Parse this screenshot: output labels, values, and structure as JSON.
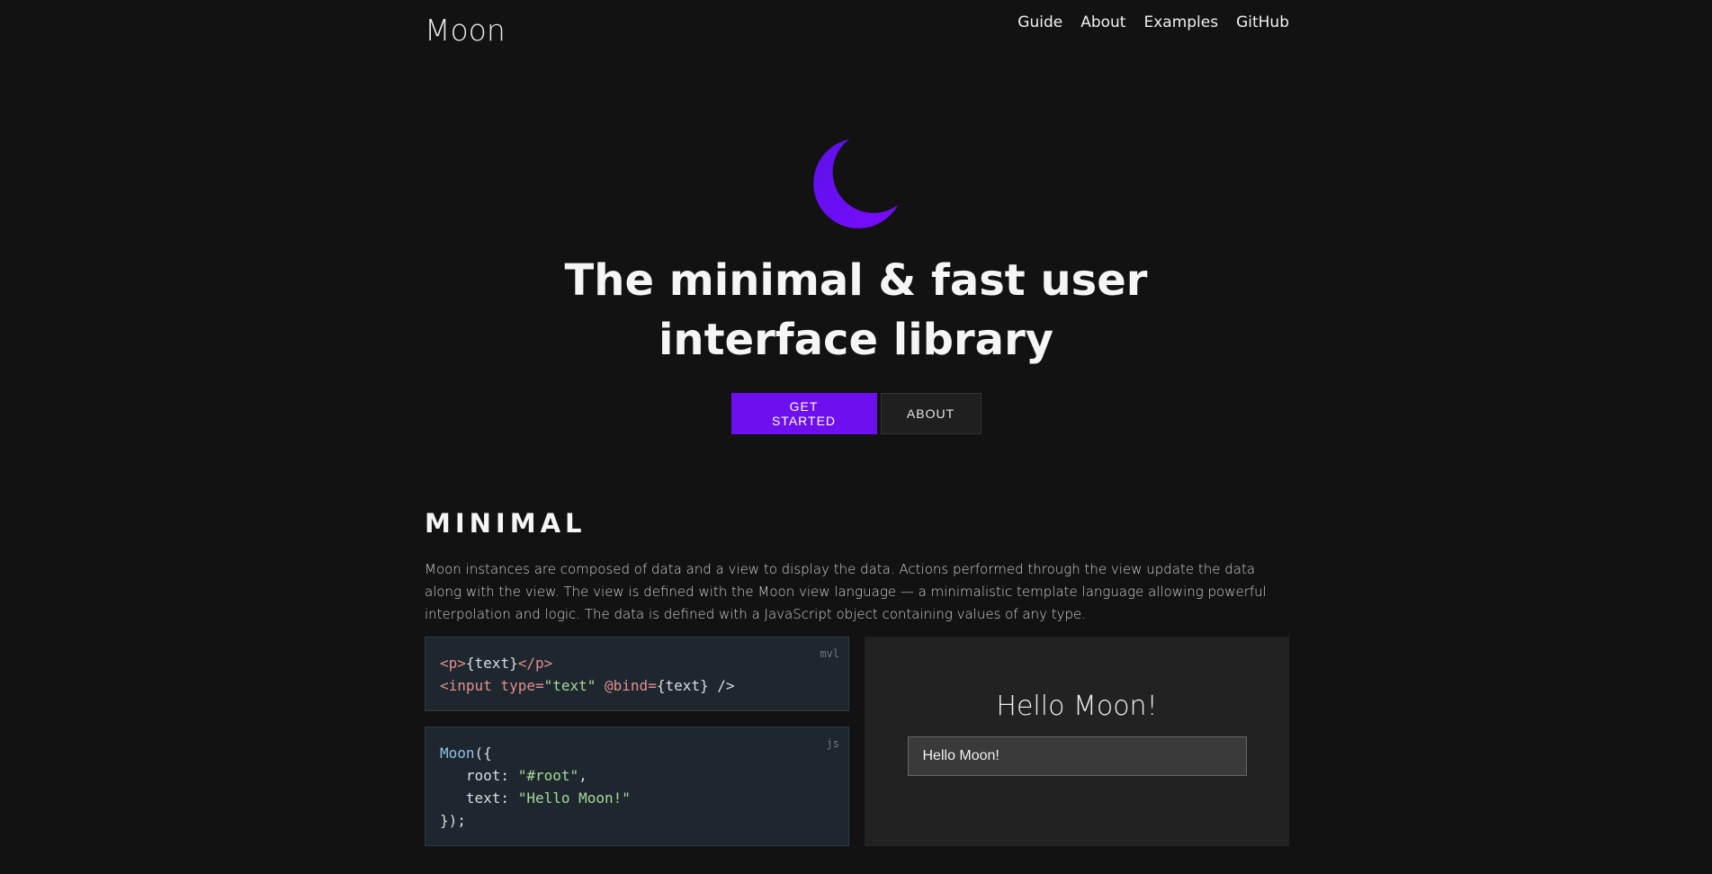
{
  "header": {
    "logo": "Moon",
    "nav": [
      "Guide",
      "About",
      "Examples",
      "GitHub"
    ]
  },
  "hero": {
    "icon": "moon-icon",
    "headline_line1": "The minimal & fast user",
    "headline_line2": "interface library",
    "primary_button": "GET STARTED",
    "secondary_button": "ABOUT"
  },
  "minimal": {
    "title": "MINIMAL",
    "description": "Moon instances are composed of data and a view to display the data. Actions performed through the view update the data along with the view. The view is defined with the Moon view language — a minimalistic template language allowing powerful interpolation and logic. The data is defined with a JavaScript object containing values of any type.",
    "mvl_label": "mvl",
    "mvl_line1_open": "<p>",
    "mvl_line1_text": "{text}",
    "mvl_line1_close": "</p>",
    "mvl_line2_tag": "<input",
    "mvl_line2_attr": " type=",
    "mvl_line2_str": "\"text\"",
    "mvl_line2_bind": " @bind=",
    "mvl_line2_rest": "{text} />",
    "js_label": "js",
    "js_line1_fn": "Moon",
    "js_line1_rest": "({",
    "js_line2_key": "   root: ",
    "js_line2_str": "\"#root\"",
    "js_line2_end": ",",
    "js_line3_key": "   text: ",
    "js_line3_str": "\"Hello Moon!\"",
    "js_line4": "});",
    "demo_text": "Hello Moon!",
    "demo_input_value": "Hello Moon!"
  },
  "colors": {
    "background": "#121212",
    "accent": "#6e0ff0"
  }
}
